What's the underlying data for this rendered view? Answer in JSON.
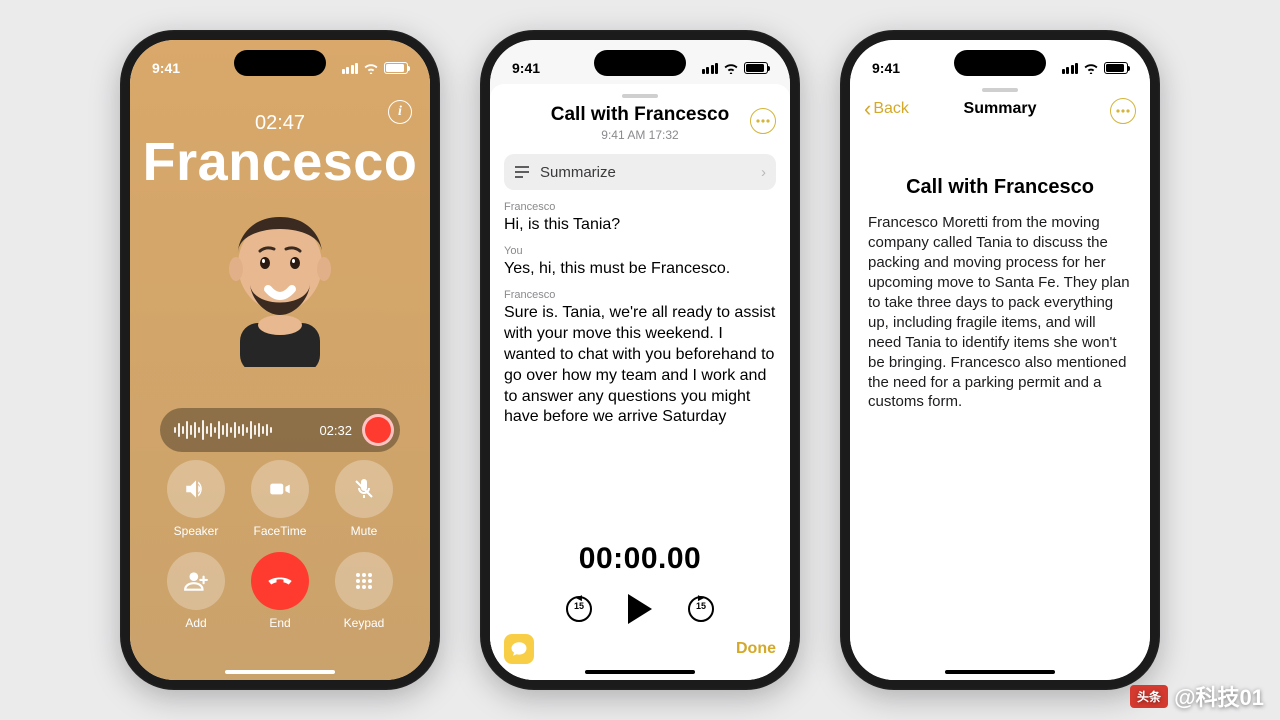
{
  "status": {
    "time": "9:41"
  },
  "phone1": {
    "timer": "02:47",
    "name": "Francesco",
    "recording_time": "02:32",
    "buttons": {
      "speaker": "Speaker",
      "facetime": "FaceTime",
      "mute": "Mute",
      "add": "Add",
      "end": "End",
      "keypad": "Keypad"
    }
  },
  "phone2": {
    "title": "Call with Francesco",
    "subtitle": "9:41 AM  17:32",
    "summarize_label": "Summarize",
    "transcript": [
      {
        "speaker": "Francesco",
        "text": "Hi, is this Tania?"
      },
      {
        "speaker": "You",
        "text": "Yes, hi, this must be Francesco."
      },
      {
        "speaker": "Francesco",
        "text": "Sure is. Tania, we're all ready to assist with your move this weekend. I wanted to chat with you beforehand to go over how my team and I work and to answer any questions you might have before we arrive Saturday"
      }
    ],
    "player_time": "00:00.00",
    "skip_seconds": "15",
    "done_label": "Done"
  },
  "phone3": {
    "back_label": "Back",
    "nav_title": "Summary",
    "heading": "Call with Francesco",
    "body": "Francesco Moretti from the moving company called Tania to discuss the packing and moving process for her upcoming move to Santa Fe. They plan to take three days to pack everything up, including fragile items, and will need Tania to identify items she won't be bringing. Francesco also mentioned the need for a parking permit and a customs form."
  },
  "watermark": {
    "badge": "头条",
    "text": "@科技01"
  }
}
